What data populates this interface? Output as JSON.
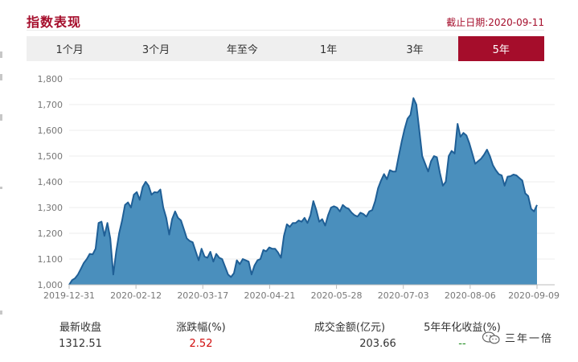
{
  "header": {
    "title": "指数表现",
    "cutoff_date": "截止日期:2020-09-11"
  },
  "tabs": [
    {
      "label": "1个月",
      "active": false
    },
    {
      "label": "3个月",
      "active": false
    },
    {
      "label": "年至今",
      "active": false
    },
    {
      "label": "1年",
      "active": false
    },
    {
      "label": "3年",
      "active": false
    },
    {
      "label": "5年",
      "active": true
    }
  ],
  "colors": {
    "accent": "#a50d2b",
    "area_fill": "#4a8fbd",
    "line": "#1f5f96",
    "up": "#d10d0d",
    "down": "#1a8a1a"
  },
  "chart_data": {
    "type": "area",
    "title": "",
    "xlabel": "",
    "ylabel": "",
    "ylim": [
      1000,
      1800
    ],
    "yticks": [
      1000,
      1100,
      1200,
      1300,
      1400,
      1500,
      1600,
      1700,
      1800
    ],
    "ytick_labels": [
      "1,000",
      "1,100",
      "1,200",
      "1,300",
      "1,400",
      "1,500",
      "1,600",
      "1,700",
      "1,800"
    ],
    "xtick_labels": [
      "2019-12-31",
      "2020-02-12",
      "2020-03-17",
      "2020-04-21",
      "2020-05-28",
      "2020-07-03",
      "2020-08-06",
      "2020-09-09"
    ],
    "grid": true,
    "legend": "none",
    "series": [
      {
        "values": [
          1000,
          1018,
          1025,
          1040,
          1062,
          1085,
          1100,
          1120,
          1118,
          1140,
          1240,
          1245,
          1190,
          1240,
          1180,
          1040,
          1130,
          1200,
          1250,
          1310,
          1320,
          1300,
          1350,
          1360,
          1330,
          1380,
          1400,
          1385,
          1350,
          1360,
          1358,
          1370,
          1300,
          1260,
          1195,
          1255,
          1285,
          1260,
          1250,
          1215,
          1180,
          1170,
          1165,
          1130,
          1095,
          1140,
          1110,
          1105,
          1128,
          1090,
          1120,
          1105,
          1100,
          1070,
          1040,
          1030,
          1045,
          1095,
          1080,
          1100,
          1095,
          1090,
          1040,
          1075,
          1095,
          1100,
          1135,
          1130,
          1145,
          1140,
          1140,
          1125,
          1105,
          1190,
          1235,
          1225,
          1240,
          1240,
          1250,
          1245,
          1260,
          1240,
          1270,
          1325,
          1290,
          1245,
          1255,
          1230,
          1270,
          1300,
          1305,
          1300,
          1285,
          1310,
          1300,
          1295,
          1280,
          1270,
          1265,
          1280,
          1275,
          1265,
          1285,
          1290,
          1325,
          1375,
          1405,
          1430,
          1410,
          1445,
          1440,
          1440,
          1500,
          1555,
          1605,
          1645,
          1660,
          1725,
          1700,
          1600,
          1500,
          1470,
          1440,
          1480,
          1500,
          1495,
          1435,
          1385,
          1400,
          1500,
          1520,
          1510,
          1625,
          1575,
          1590,
          1580,
          1550,
          1510,
          1470,
          1480,
          1490,
          1505,
          1525,
          1500,
          1465,
          1445,
          1430,
          1425,
          1385,
          1420,
          1422,
          1428,
          1425,
          1415,
          1405,
          1355,
          1345,
          1295,
          1285,
          1310
        ]
      }
    ]
  },
  "stats": [
    {
      "label": "最新收盘",
      "value": "1312.51",
      "tone": "normal"
    },
    {
      "label": "涨跌幅(%)",
      "value": "2.52",
      "tone": "red"
    },
    {
      "label": "成交金额(亿元)",
      "value": "203.66",
      "tone": "normal"
    },
    {
      "label": "5年年化收益(%)",
      "value": "--",
      "tone": "green"
    }
  ],
  "watermark": {
    "text": "三年一倍",
    "icon": "wechat-icon"
  }
}
